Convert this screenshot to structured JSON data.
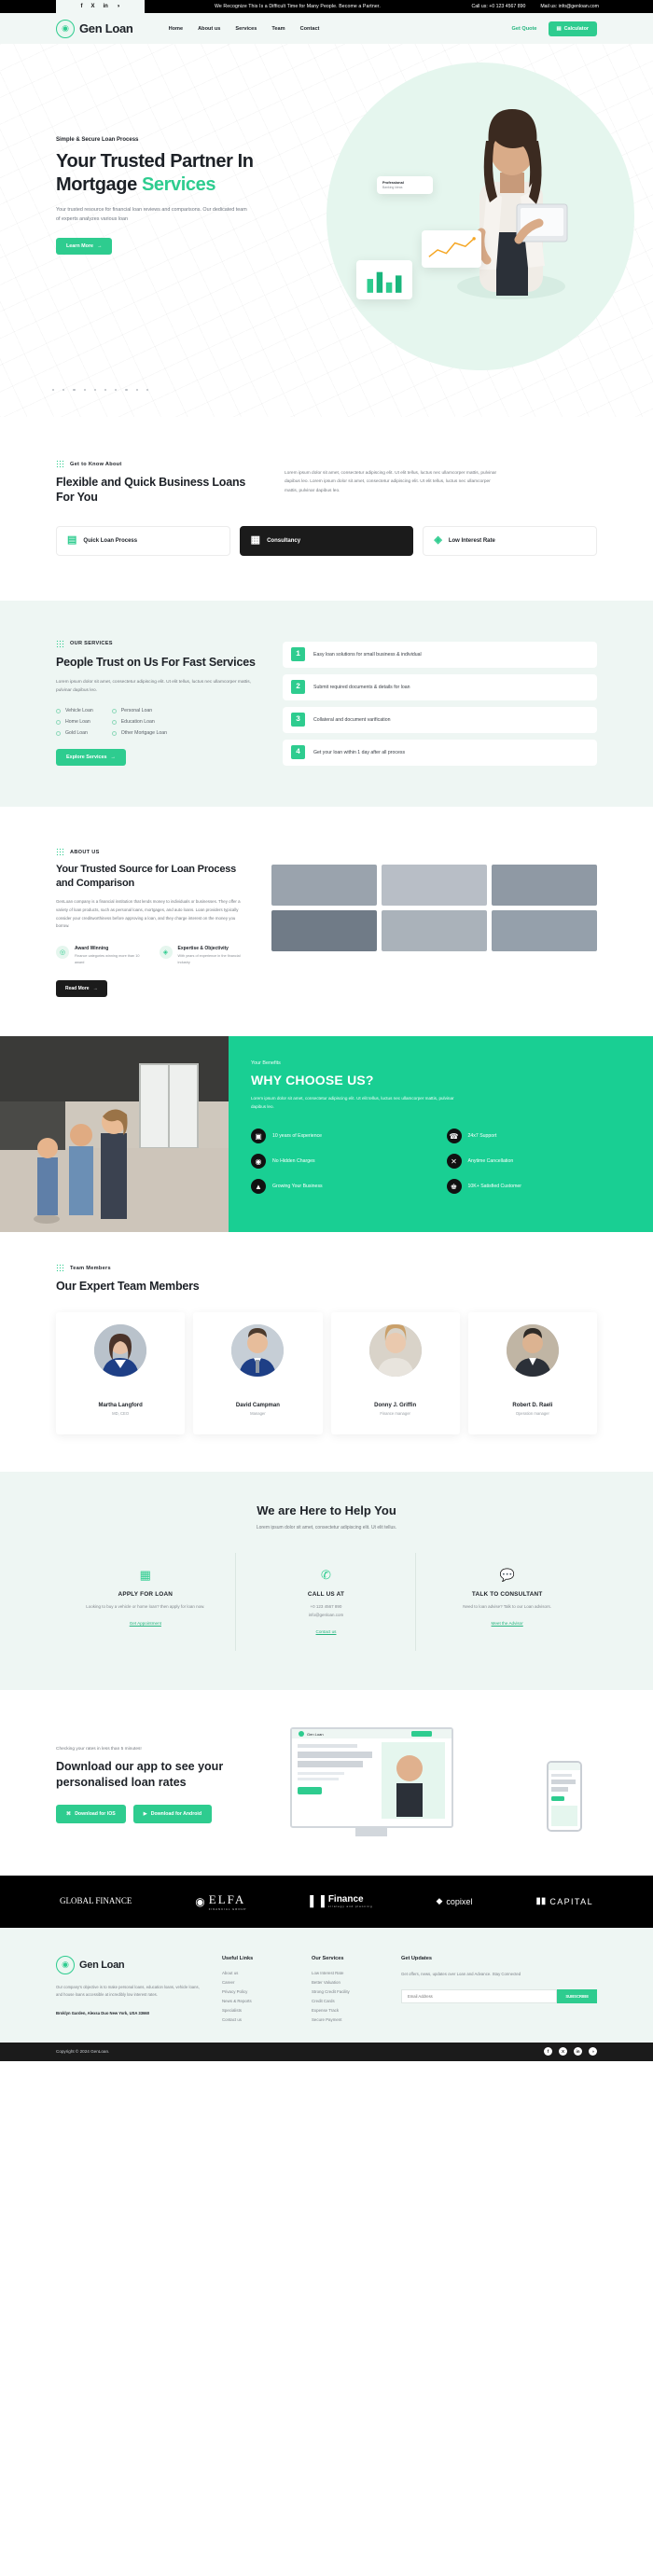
{
  "topbar": {
    "social": [
      "f",
      "X",
      "in",
      "◑"
    ],
    "message": "We Recognize This Is a Difficult Time for Many People. Become a Partner.",
    "call": "Call us: +0 123 4567 890",
    "mail": "Mail us: info@genloan.com"
  },
  "nav": {
    "brand": "Gen Loan",
    "links": [
      "Home",
      "About us",
      "Services",
      "Team",
      "Contact"
    ],
    "quote": "Get Quote",
    "calculator": "Calculator"
  },
  "hero": {
    "eyebrow": "Simple & Secure Loan Process",
    "title_line1": "Your Trusted Partner In",
    "title_line2_plain": "Mortgage ",
    "title_line2_accent": "Services",
    "subtitle": "Your trusted resource for financial loan reviews and comparisons. Our dedicated team of experts analyzes various loan",
    "cta": "Learn More",
    "card_professional": "Professional",
    "card_professional_sub": "Banking Ideas"
  },
  "about": {
    "eyebrow": "Get to Know About",
    "title": "Flexible and Quick Business Loans For You",
    "paragraph": "Lorem ipsum dolor sit amet, consectetur adipiscing elit. Ut elit tellus, luctus nec ullamcorper mattis, pulvinar dapibus leo. Lorem ipsum dolor sit amet, consectetur adipiscing elit. Ut elit tellus, luctus nec ullamcorper mattis, pulvinar dapibus leo.",
    "pills": [
      {
        "label": "Quick Loan Process",
        "icon": "cheque-icon"
      },
      {
        "label": "Consultancy",
        "icon": "presentation-icon"
      },
      {
        "label": "Low Interest Rate",
        "icon": "rate-icon"
      }
    ]
  },
  "services": {
    "eyebrow": "OUR SERVICES",
    "title": "People Trust on Us For Fast Services",
    "paragraph": "Lorem ipsum dolor sit amet, consectetur adipiscing elit. Ut elit tellus, luctus nec ullamcorper mattis, pulvinar dapibus leo.",
    "list_left": [
      "Vehicle Loan",
      "Home Loan",
      "Gold Loan"
    ],
    "list_right": [
      "Personal Loan",
      "Education Loan",
      "Other Mortgage Loan"
    ],
    "cta": "Explore Services",
    "steps": [
      {
        "num": "1",
        "text": "Easy loan solutions for small business & individual"
      },
      {
        "num": "2",
        "text": "Submit required documents & details for loan"
      },
      {
        "num": "3",
        "text": "Collateral and document varification"
      },
      {
        "num": "4",
        "text": "Get your loan within 1 day after all process"
      }
    ]
  },
  "aboutus": {
    "eyebrow": "ABOUT US",
    "title": "Your Trusted Source for Loan Process and Comparison",
    "paragraph": "GenLoan company is a financial institution that lends money to individuals or businesses. They offer a variety of loan products, such as personal loans, mortgages, and auto loans. Loan providers typically consider your creditworthiness before approving a loan, and they charge interest on the money you borrow.",
    "badges": [
      {
        "title": "Award Winning",
        "desc": "Finance categories winning more than 10 award",
        "icon": "award-icon"
      },
      {
        "title": "Expertise & Objectivity",
        "desc": "With years of experience in the financial industry",
        "icon": "expertise-icon"
      }
    ],
    "cta": "Read More"
  },
  "why": {
    "eyebrow": "Your Benefits",
    "title": "WHY CHOOSE US?",
    "paragraph": "Lorem ipsum dolor sit amet, consectetur adipiscing elit. Ut elit tellus, luctus nec ullamcorper mattis, pulvinar dapibus leo.",
    "items": [
      {
        "label": "10 years of Experience",
        "icon": "calendar-check-icon"
      },
      {
        "label": "24x7 Support",
        "icon": "headset-icon"
      },
      {
        "label": "No Hidden Charges",
        "icon": "money-icon"
      },
      {
        "label": "Anytime Cancellation",
        "icon": "close-circle-icon"
      },
      {
        "label": "Growing Your Business",
        "icon": "growth-icon"
      },
      {
        "label": "10K+ Satisfied Customer",
        "icon": "customer-icon"
      }
    ]
  },
  "team": {
    "eyebrow": "Team Members",
    "title": "Our Expert Team Members",
    "members": [
      {
        "name": "Martha Langford",
        "role": "MD, CEO"
      },
      {
        "name": "David Campman",
        "role": "Manager"
      },
      {
        "name": "Donny J. Griffin",
        "role": "Finance manager"
      },
      {
        "name": "Robert D. Raeli",
        "role": "Operation manager"
      }
    ]
  },
  "help": {
    "title": "We are Here to Help You",
    "subtitle": "Lorem ipsum dolor sit amet, consectetur adipiscing elit. Ut elit tellus.",
    "cards": [
      {
        "icon": "calendar-icon",
        "title": "APPLY FOR LOAN",
        "desc": "Looking to buy a vehicle or home loan? then apply for loan now.",
        "link": "Get Appointment"
      },
      {
        "icon": "phone-icon",
        "title": "CALL US AT",
        "desc": "+0 123 4567 890\ninfo@genloan.com",
        "link": "Contact us"
      },
      {
        "icon": "chat-icon",
        "title": "TALK TO CONSULTANT",
        "desc": "Need to loan advise? Talk to our Loan advisors.",
        "link": "Meet the Advisor"
      }
    ]
  },
  "app": {
    "eyebrow": "Checking your rates in less than 5 minutes!",
    "title": "Download our app to see your personalised loan rates",
    "btn_ios": "Download for IOS",
    "btn_android": "Download for Android"
  },
  "logos": [
    {
      "name": "GLOBAL FINANCE",
      "sub": ""
    },
    {
      "name": "ELFA",
      "sub": "FINANCIAL GROUP"
    },
    {
      "name": "Finance",
      "sub": "strategy and planning"
    },
    {
      "name": "copixel",
      "sub": ""
    },
    {
      "name": "CAPITAL",
      "sub": ""
    }
  ],
  "footer": {
    "brand": "Gen Loan",
    "about": "Our company's objective is to make personal loans, education loans, vehicle loans, and house loans accessible at incredibly low interest rates.",
    "address": "Broklyn Garden, Alexsa Duo New York, USA 33660",
    "col_useful": {
      "head": "Useful Links",
      "links": [
        "About us",
        "Career",
        "Privacy Policy",
        "News & Reports",
        "Specialists",
        "Contact us"
      ]
    },
    "col_services": {
      "head": "Our Services",
      "links": [
        "Low Interest Rate",
        "Better Valuation",
        "Strong Credit Facility",
        "Credit Cards",
        "Expense Track",
        "Secure Payment"
      ]
    },
    "col_updates": {
      "head": "Get Updates",
      "text": "Get offers, news, updates over Loan and Advance. Stay Connected",
      "placeholder": "Email Address",
      "button": "SUBSCRIBE"
    },
    "copyright": "Copyright © 2024 GenLoan.",
    "social": [
      "f",
      "X",
      "in",
      "◑"
    ]
  },
  "colors": {
    "accent": "#2ecc8f",
    "accent_strong": "#19cf93",
    "dark": "#1b1b1b",
    "tint": "#eef6f3"
  }
}
